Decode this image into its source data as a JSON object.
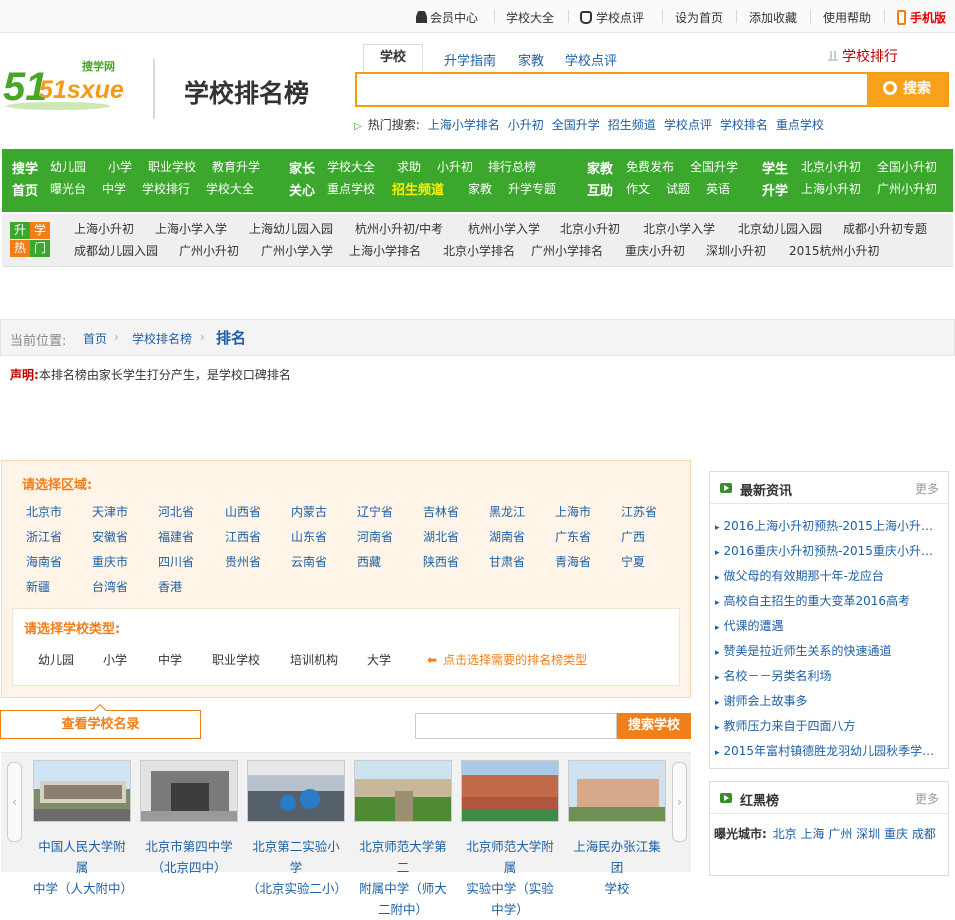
{
  "topbar": {
    "member": "会员中心",
    "school_all": "学校大全",
    "school_review": "学校点评",
    "set_home": "设为首页",
    "bookmark": "添加收藏",
    "help": "使用帮助",
    "mobile": "手机版"
  },
  "header": {
    "logo_cn": "搜学网",
    "logo_en": "51sxue",
    "site_title": "学校排名榜",
    "tabs": [
      "学校",
      "升学指南",
      "家教",
      "学校点评"
    ],
    "rank_link": "学校排行",
    "search_button": "搜索",
    "hot_label": "热门搜索:",
    "hot_links": [
      "上海小学排名",
      "小升初",
      "全国升学",
      "招生频道",
      "学校点评",
      "学校排名",
      "重点学校"
    ]
  },
  "nav": {
    "groups": [
      {
        "t1": "搜学",
        "t2": "首页",
        "row1": [
          "幼儿园",
          "小学",
          "职业学校",
          "教育升学"
        ],
        "row2": [
          "曝光台",
          "中学",
          "学校排行",
          "学校大全"
        ]
      },
      {
        "t1": "家长",
        "t2": "关心",
        "row1": [
          "学校大全",
          "求助",
          "小升初",
          "排行总榜"
        ],
        "row2": [
          "重点学校",
          "招生频道",
          "家教",
          "升学专题"
        ]
      },
      {
        "t1": "家教",
        "t2": "互助",
        "row1": [
          "免费发布",
          "全国升学"
        ],
        "row2": [
          "作文",
          "试题",
          "英语"
        ]
      },
      {
        "t1": "学生",
        "t2": "升学",
        "row1": [
          "北京小升初",
          "全国小升初"
        ],
        "row2": [
          "上海小升初",
          "广州小升初"
        ]
      }
    ]
  },
  "hotbar": {
    "badge_top": "升学",
    "badge_bottom": "热门",
    "row1": [
      "上海小升初",
      "上海小学入学",
      "上海幼儿园入园",
      "杭州小升初/中考",
      "杭州小学入学",
      "北京小升初",
      "北京小学入学",
      "北京幼儿园入园",
      "成都小升初专题"
    ],
    "row2": [
      "成都幼儿园入园",
      "广州小升初",
      "广州小学入学",
      "上海小学排名",
      "北京小学排名",
      "广州小学排名",
      "重庆小升初",
      "深圳小升初",
      "2015杭州小升初"
    ]
  },
  "crumb": {
    "label": "当前位置:",
    "home": "首页",
    "rank": "学校排名榜",
    "current": "排名"
  },
  "notice": {
    "label": "声明:",
    "text": "本排名榜由家长学生打分产生，是学校口碑排名"
  },
  "filter": {
    "region_title": "请选择区域:",
    "regions": [
      [
        "北京市",
        "天津市",
        "河北省",
        "山西省",
        "内蒙古",
        "辽宁省",
        "吉林省",
        "黑龙江",
        "上海市",
        "江苏省"
      ],
      [
        "浙江省",
        "安徽省",
        "福建省",
        "江西省",
        "山东省",
        "河南省",
        "湖北省",
        "湖南省",
        "广东省",
        "广西"
      ],
      [
        "海南省",
        "重庆市",
        "四川省",
        "贵州省",
        "云南省",
        "西藏",
        "陕西省",
        "甘肃省",
        "青海省",
        "宁夏"
      ],
      [
        "新疆",
        "台湾省",
        "香港"
      ]
    ],
    "type_title": "请选择学校类型:",
    "types": [
      "幼儿园",
      "小学",
      "中学",
      "职业学校",
      "培训机构",
      "大学"
    ],
    "type_hint": "点击选择需要的排名榜类型"
  },
  "actions": {
    "view_button": "查看学校名录",
    "search_button": "搜索学校"
  },
  "carousel": {
    "schools": [
      {
        "name": "中国人民大学附属",
        "name2": "中学（人大附中）"
      },
      {
        "name": "北京市第四中学",
        "name2": "（北京四中）"
      },
      {
        "name": "北京第二实验小学",
        "name2": "（北京实验二小）"
      },
      {
        "name": "北京师范大学第二",
        "name2": "附属中学（师大二附中）"
      },
      {
        "name": "北京师范大学附属",
        "name2": "实验中学（实验中学）"
      },
      {
        "name": "上海民办张江集团",
        "name2": "学校"
      }
    ]
  },
  "sidebar": {
    "news_title": "最新资讯",
    "more": "更多",
    "news": [
      "2016上海小升初预热-2015上海小升初…",
      "2016重庆小升初预热-2015重庆小升初…",
      "做父母的有效期那十年-龙应台",
      "高校自主招生的重大变革2016高考",
      "代课的遭遇",
      "赞美是拉近师生关系的快速通道",
      "名校－－另类名利场",
      "谢师会上故事多",
      "教师压力来自于四面八方",
      "2015年富村镇德胜龙羽幼儿园秋季学…"
    ],
    "rank_title": "红黑榜",
    "city_label": "曝光城市:",
    "cities": [
      "北京",
      "上海",
      "广州",
      "深圳",
      "重庆",
      "成都"
    ]
  },
  "colors": {
    "green": "#3ba72d",
    "orange": "#f07f1a",
    "link_blue": "#1d5fa5"
  }
}
